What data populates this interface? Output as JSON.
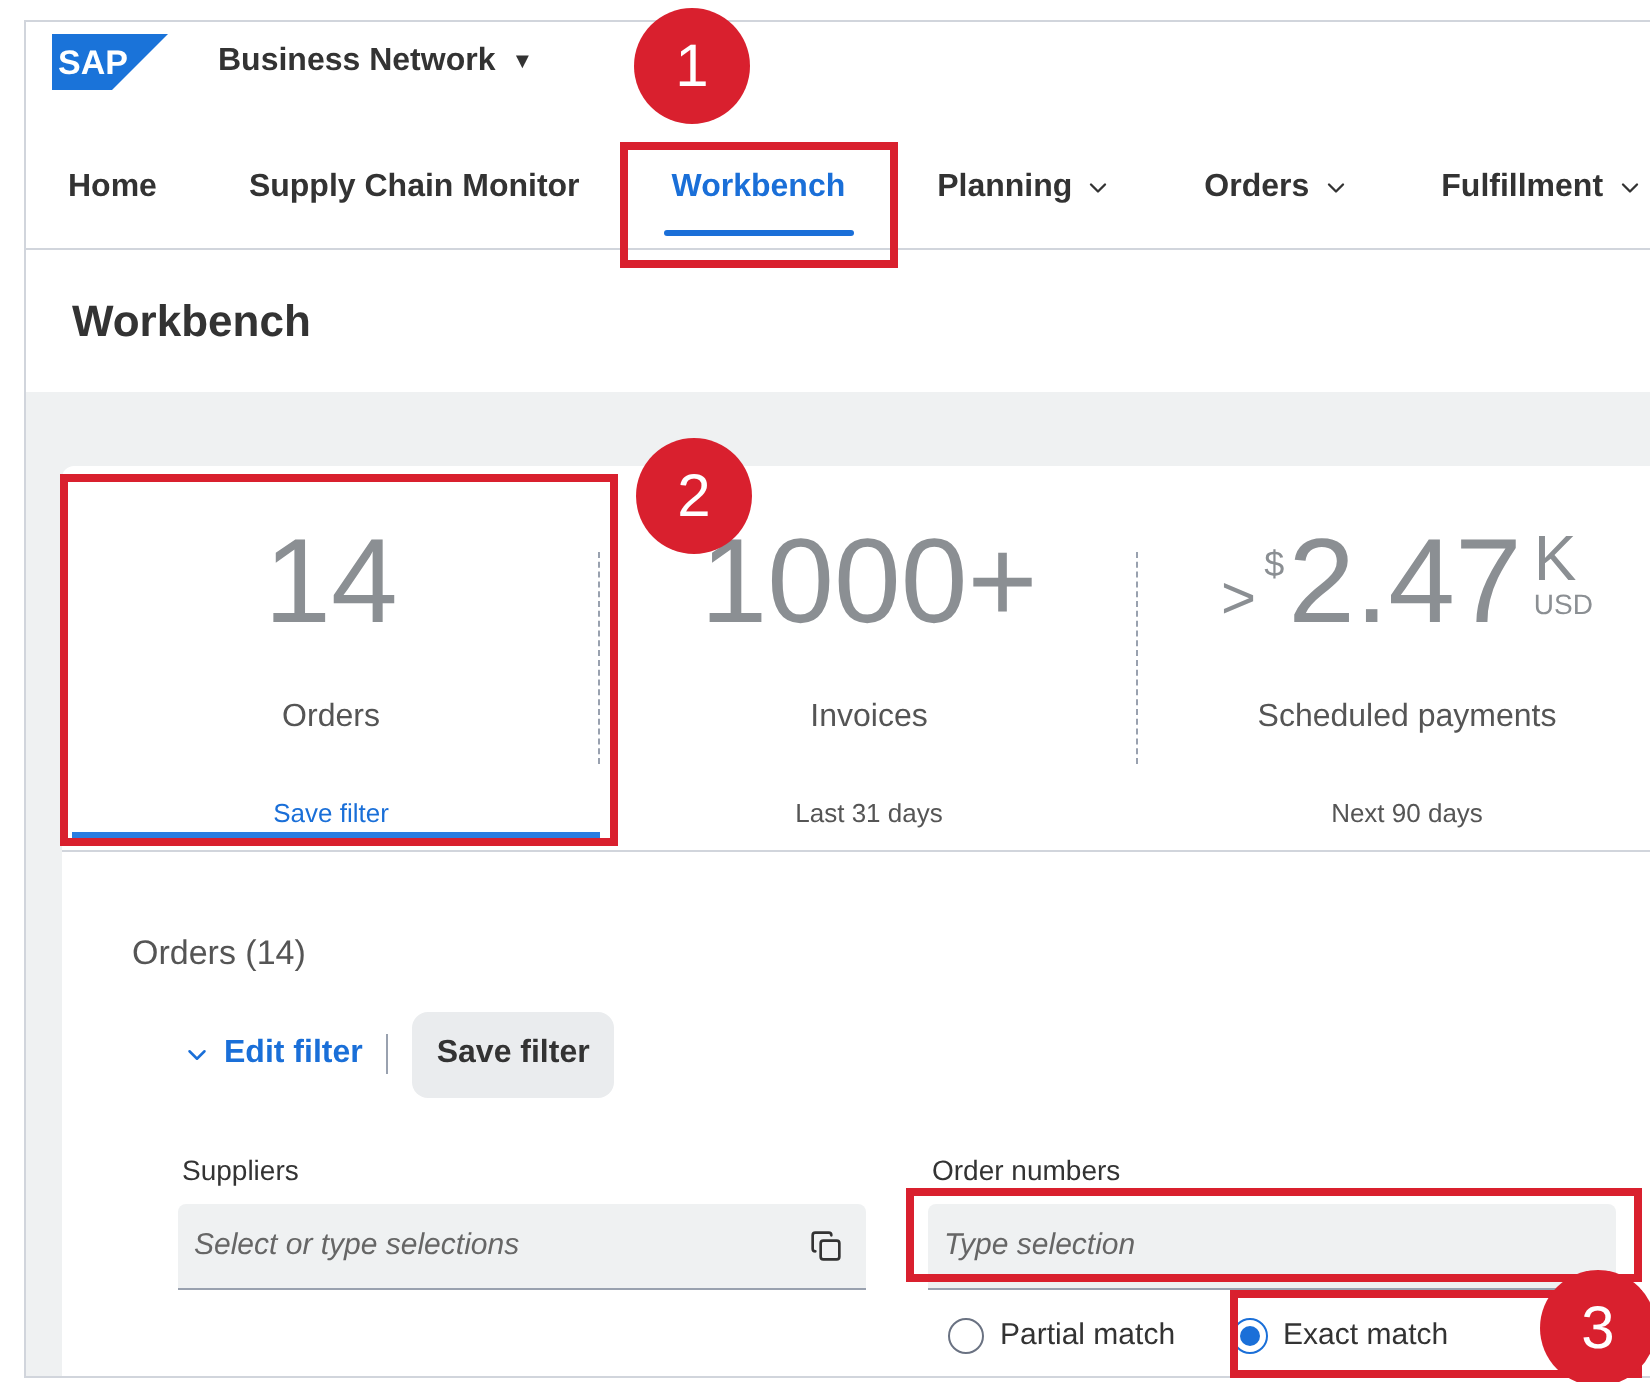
{
  "header": {
    "logo": "SAP",
    "product": "Business Network",
    "product_caret": "▼"
  },
  "nav": [
    {
      "label": "Home",
      "selected": false,
      "dropdown": false
    },
    {
      "label": "Supply Chain Monitor",
      "selected": false,
      "dropdown": false
    },
    {
      "label": "Workbench",
      "selected": true,
      "dropdown": false
    },
    {
      "label": "Planning",
      "selected": false,
      "dropdown": true
    },
    {
      "label": "Orders",
      "selected": false,
      "dropdown": true
    },
    {
      "label": "Fulfillment",
      "selected": false,
      "dropdown": true
    }
  ],
  "page_title": "Workbench",
  "tiles": [
    {
      "value": "14",
      "label": "Orders",
      "footer": "Save filter",
      "footer_link": true,
      "selected": true
    },
    {
      "value": "1000+",
      "label": "Invoices",
      "footer": "Last 31 days",
      "footer_link": false,
      "selected": false
    },
    {
      "prefix": ">",
      "currency": "$",
      "value": "2.47",
      "unit": "K",
      "unit_sub": "USD",
      "label": "Scheduled payments",
      "footer": "Next 90 days",
      "footer_link": false,
      "selected": false
    }
  ],
  "filter": {
    "title": "Orders (14)",
    "edit_label": "Edit filter",
    "save_label": "Save filter",
    "fields": [
      {
        "label": "Suppliers",
        "placeholder": "Select or type selections",
        "kind": "multi"
      },
      {
        "label": "Order numbers",
        "placeholder": "Type selection",
        "kind": "text"
      }
    ],
    "match_options": [
      {
        "label": "Partial match",
        "selected": false
      },
      {
        "label": "Exact match",
        "selected": true
      }
    ]
  },
  "callouts": [
    {
      "number": "1"
    },
    {
      "number": "2"
    },
    {
      "number": "3"
    }
  ]
}
